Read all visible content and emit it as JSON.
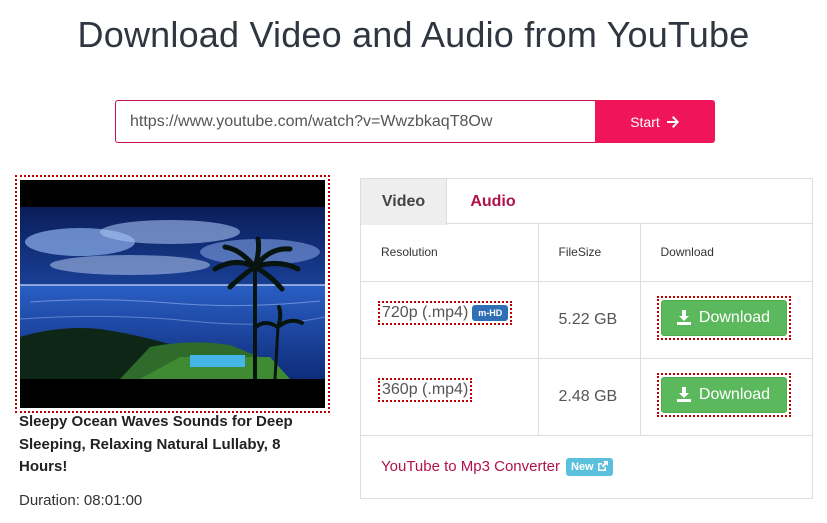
{
  "header": {
    "title": "Download Video and Audio from YouTube"
  },
  "search": {
    "url_value": "https://www.youtube.com/watch?v=WwzbkaqT8Ow",
    "start_label": "Start"
  },
  "video": {
    "title": "Sleepy Ocean Waves Sounds for Deep Sleeping, Relaxing Natural Lullaby, 8 Hours!",
    "duration_label": "Duration:",
    "duration_value": "08:01:00"
  },
  "tabs": [
    {
      "label": "Video",
      "active": true
    },
    {
      "label": "Audio",
      "active": false
    }
  ],
  "table": {
    "headers": [
      "Resolution",
      "FileSize",
      "Download"
    ],
    "rows": [
      {
        "resolution": "720p (.mp4)",
        "badge": "m-HD",
        "filesize": "5.22 GB",
        "action": "Download"
      },
      {
        "resolution": "360p (.mp4)",
        "badge": "",
        "filesize": "2.48 GB",
        "action": "Download"
      }
    ]
  },
  "converter": {
    "link": "YouTube to Mp3 Converter",
    "badge": "New"
  },
  "colors": {
    "accent": "#f0145a",
    "link": "#b0124c",
    "download": "#5cb85c",
    "hd_badge": "#2f6fb6",
    "new_badge": "#5bc0de"
  },
  "icons": {
    "start": "arrow-right-icon",
    "download": "download-icon",
    "new": "external-link-icon"
  }
}
